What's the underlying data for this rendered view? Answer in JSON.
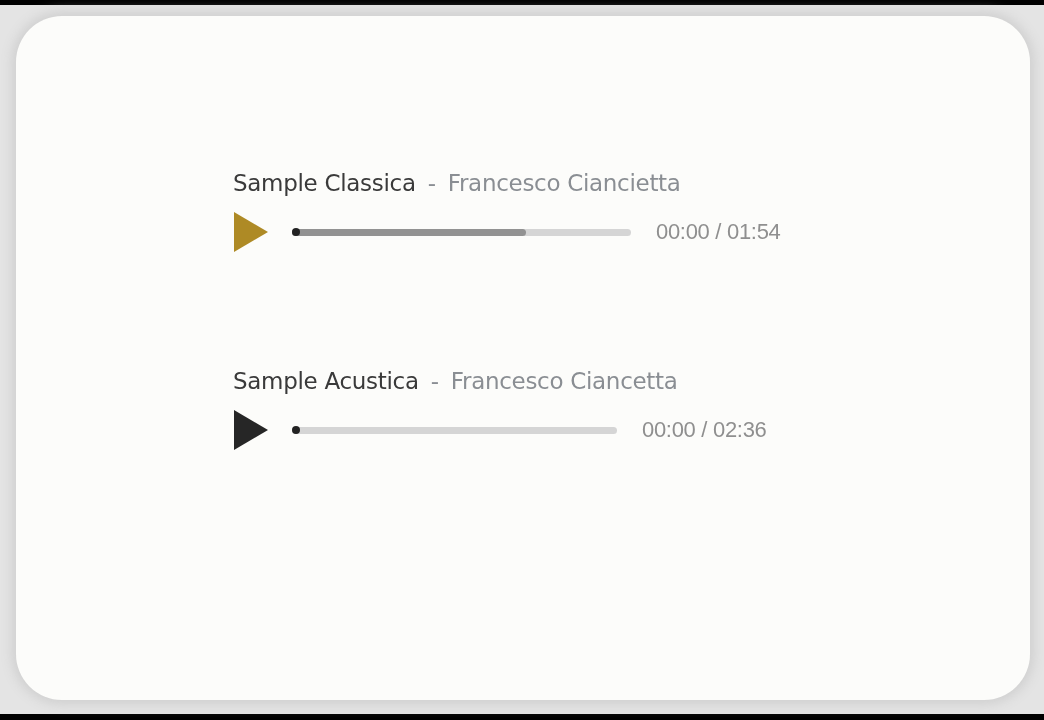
{
  "players": [
    {
      "title": "Sample Classica",
      "separator": "-",
      "artist": "Francesco Ciancietta",
      "highlighted": true,
      "level": 0.69,
      "time": "00:00 / 01:54"
    },
    {
      "title": "Sample Acustica",
      "separator": "-",
      "artist": "Francesco Ciancetta",
      "highlighted": false,
      "level": 0,
      "time": "00:00 / 02:36"
    }
  ]
}
